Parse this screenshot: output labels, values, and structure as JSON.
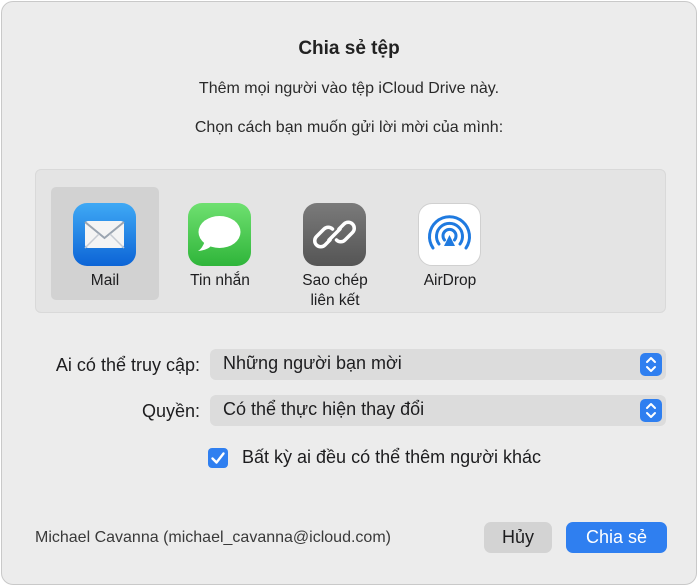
{
  "dialog": {
    "title": "Chia sẻ tệp",
    "subtitle": "Thêm mọi người vào tệp iCloud Drive này.",
    "instruction": "Chọn cách bạn muốn gửi lời mời của mình:"
  },
  "share_methods": [
    {
      "label": "Mail",
      "icon": "mail-icon",
      "selected": true
    },
    {
      "label": "Tin nhắn",
      "icon": "messages-icon",
      "selected": false
    },
    {
      "label": "Sao chép\nliên kết",
      "icon": "link-icon",
      "selected": false
    },
    {
      "label": "AirDrop",
      "icon": "airdrop-icon",
      "selected": false
    }
  ],
  "access": {
    "label": "Ai có thể truy cập:",
    "value": "Những người bạn mời"
  },
  "permission": {
    "label": "Quyền:",
    "value": "Có thể thực hiện thay đổi"
  },
  "allow_others": {
    "label": "Bất kỳ ai đều có thể thêm người khác",
    "checked": true
  },
  "account": "Michael Cavanna (michael_cavanna@icloud.com)",
  "buttons": {
    "cancel": "Hủy",
    "share": "Chia sẻ"
  },
  "colors": {
    "accent": "#2f7ff0",
    "dialog_background": "#ececec"
  }
}
